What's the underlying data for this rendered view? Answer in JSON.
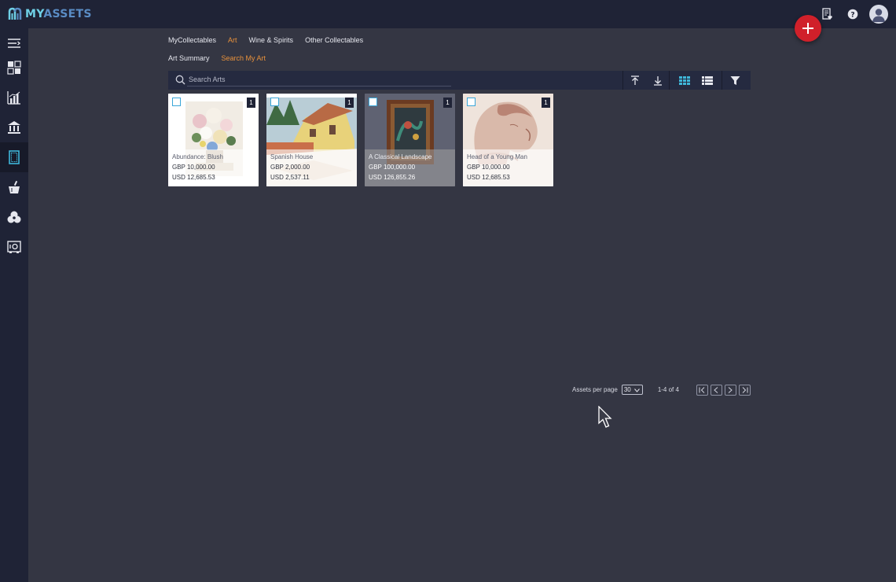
{
  "brand": {
    "name_part1": "MY",
    "name_part2": "ASSETS"
  },
  "header": {
    "icons": [
      "document-heart-icon",
      "help-icon",
      "user-avatar"
    ]
  },
  "sidebar": {
    "items": [
      {
        "icon": "menu-toggle-icon"
      },
      {
        "icon": "dashboard-icon"
      },
      {
        "icon": "analytics-chart-icon"
      },
      {
        "icon": "bank-icon"
      },
      {
        "icon": "collectables-icon",
        "active": true
      },
      {
        "icon": "wine-bucket-icon"
      },
      {
        "icon": "group-icon"
      },
      {
        "icon": "safe-icon"
      }
    ]
  },
  "tabs": [
    {
      "label": "MyCollectables",
      "active": false
    },
    {
      "label": "Art",
      "active": true
    },
    {
      "label": "Wine & Spirits",
      "active": false
    },
    {
      "label": "Other Collectables",
      "active": false
    }
  ],
  "subtabs": [
    {
      "label": "Art Summary",
      "active": false
    },
    {
      "label": "Search My Art",
      "active": true
    }
  ],
  "search": {
    "placeholder": "Search Arts",
    "value": ""
  },
  "cards": [
    {
      "title": "Abundance: Blush",
      "price_gbp": "GBP 10,000.00",
      "price_usd": "USD 12,685.53",
      "count": "1",
      "theme": "flowers"
    },
    {
      "title": "Spanish House",
      "price_gbp": "GBP 2,000.00",
      "price_usd": "USD 2,537.11",
      "count": "1",
      "theme": "house"
    },
    {
      "title": "A Classical Landscape",
      "price_gbp": "GBP 100,000.00",
      "price_usd": "USD 126,855.26",
      "count": "1",
      "theme": "framed"
    },
    {
      "title": "Head of a Young Man",
      "price_gbp": "GBP 10,000.00",
      "price_usd": "USD 12,685.53",
      "count": "1",
      "theme": "sketch"
    }
  ],
  "pagination": {
    "per_page_label": "Assets per page",
    "per_page_value": "30",
    "range_text": "1-4 of 4"
  },
  "colors": {
    "accent": "#e8913b",
    "fab": "#d0202a",
    "header_bg": "#1f2336",
    "page_bg": "#343643"
  }
}
